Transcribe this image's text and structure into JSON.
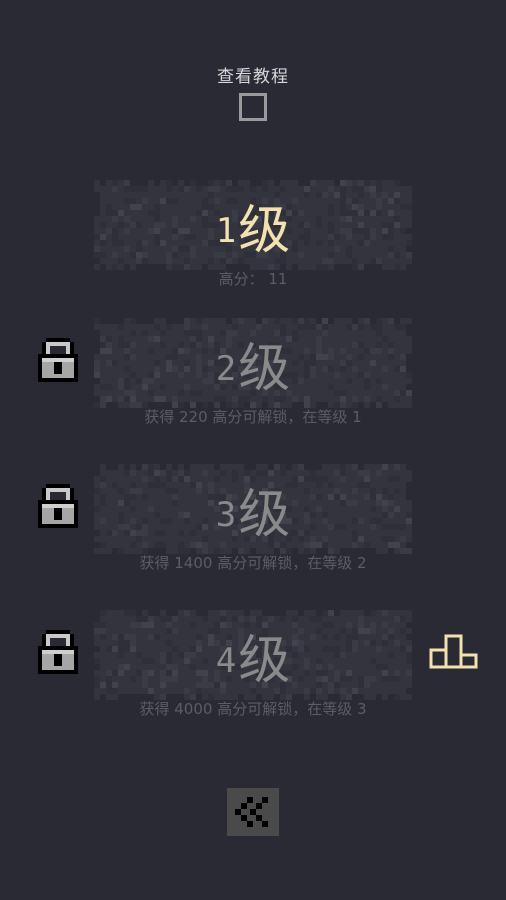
{
  "tutorial": {
    "label": "查看教程",
    "checked": false
  },
  "levels": [
    {
      "number": "1",
      "label": "级",
      "subtitle": "高分：  11",
      "locked": false
    },
    {
      "number": "2",
      "label": "级",
      "subtitle": "获得 220 高分可解锁，在等级 1",
      "locked": true
    },
    {
      "number": "3",
      "label": "级",
      "subtitle": "获得 1400 高分可解锁，在等级 2",
      "locked": true
    },
    {
      "number": "4",
      "label": "级",
      "subtitle": "获得 4000 高分可解锁，在等级 3",
      "locked": true
    }
  ],
  "icons": {
    "lock": "lock-icon",
    "podium": "podium-icon",
    "back": "double-chevron-left-icon"
  },
  "colors": {
    "background": "#2a2a35",
    "active_level": "#f3e2b0",
    "locked_level": "#8a8a8a",
    "podium": "#f3e2b0"
  }
}
